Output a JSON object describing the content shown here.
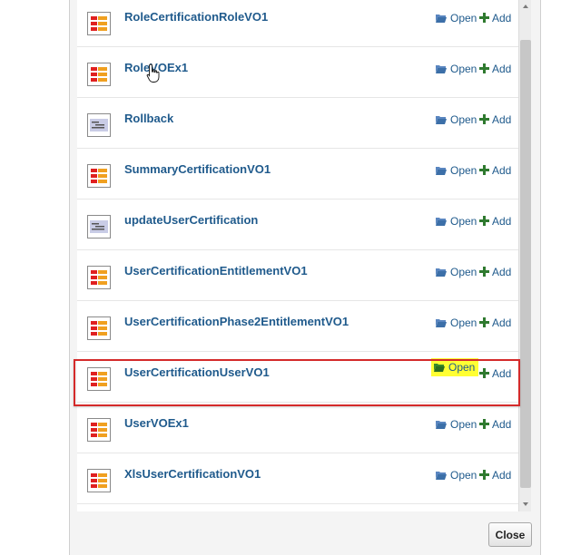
{
  "items": [
    {
      "label": "RoleCertificationRoleVO1",
      "icon": "view-object-icon"
    },
    {
      "label": "RoleVOEx1",
      "icon": "view-object-icon"
    },
    {
      "label": "Rollback",
      "icon": "operation-icon"
    },
    {
      "label": "SummaryCertificationVO1",
      "icon": "view-object-icon"
    },
    {
      "label": "updateUserCertification",
      "icon": "operation-icon"
    },
    {
      "label": "UserCertificationEntitlementVO1",
      "icon": "view-object-icon"
    },
    {
      "label": "UserCertificationPhase2EntitlementVO1",
      "icon": "view-object-icon"
    },
    {
      "label": "UserCertificationUserVO1",
      "icon": "view-object-icon",
      "highlighted": true
    },
    {
      "label": "UserVOEx1",
      "icon": "view-object-icon"
    },
    {
      "label": "XlsUserCertificationVO1",
      "icon": "view-object-icon"
    }
  ],
  "actions": {
    "open_label": "Open",
    "add_label": "Add"
  },
  "footer": {
    "close_label": "Close"
  },
  "colors": {
    "link": "#1f5a8c",
    "highlight_box": "#d42a2a",
    "open_highlight": "#ffff33",
    "folder": "#3c6fa8",
    "plus": "#2f7a2f"
  }
}
